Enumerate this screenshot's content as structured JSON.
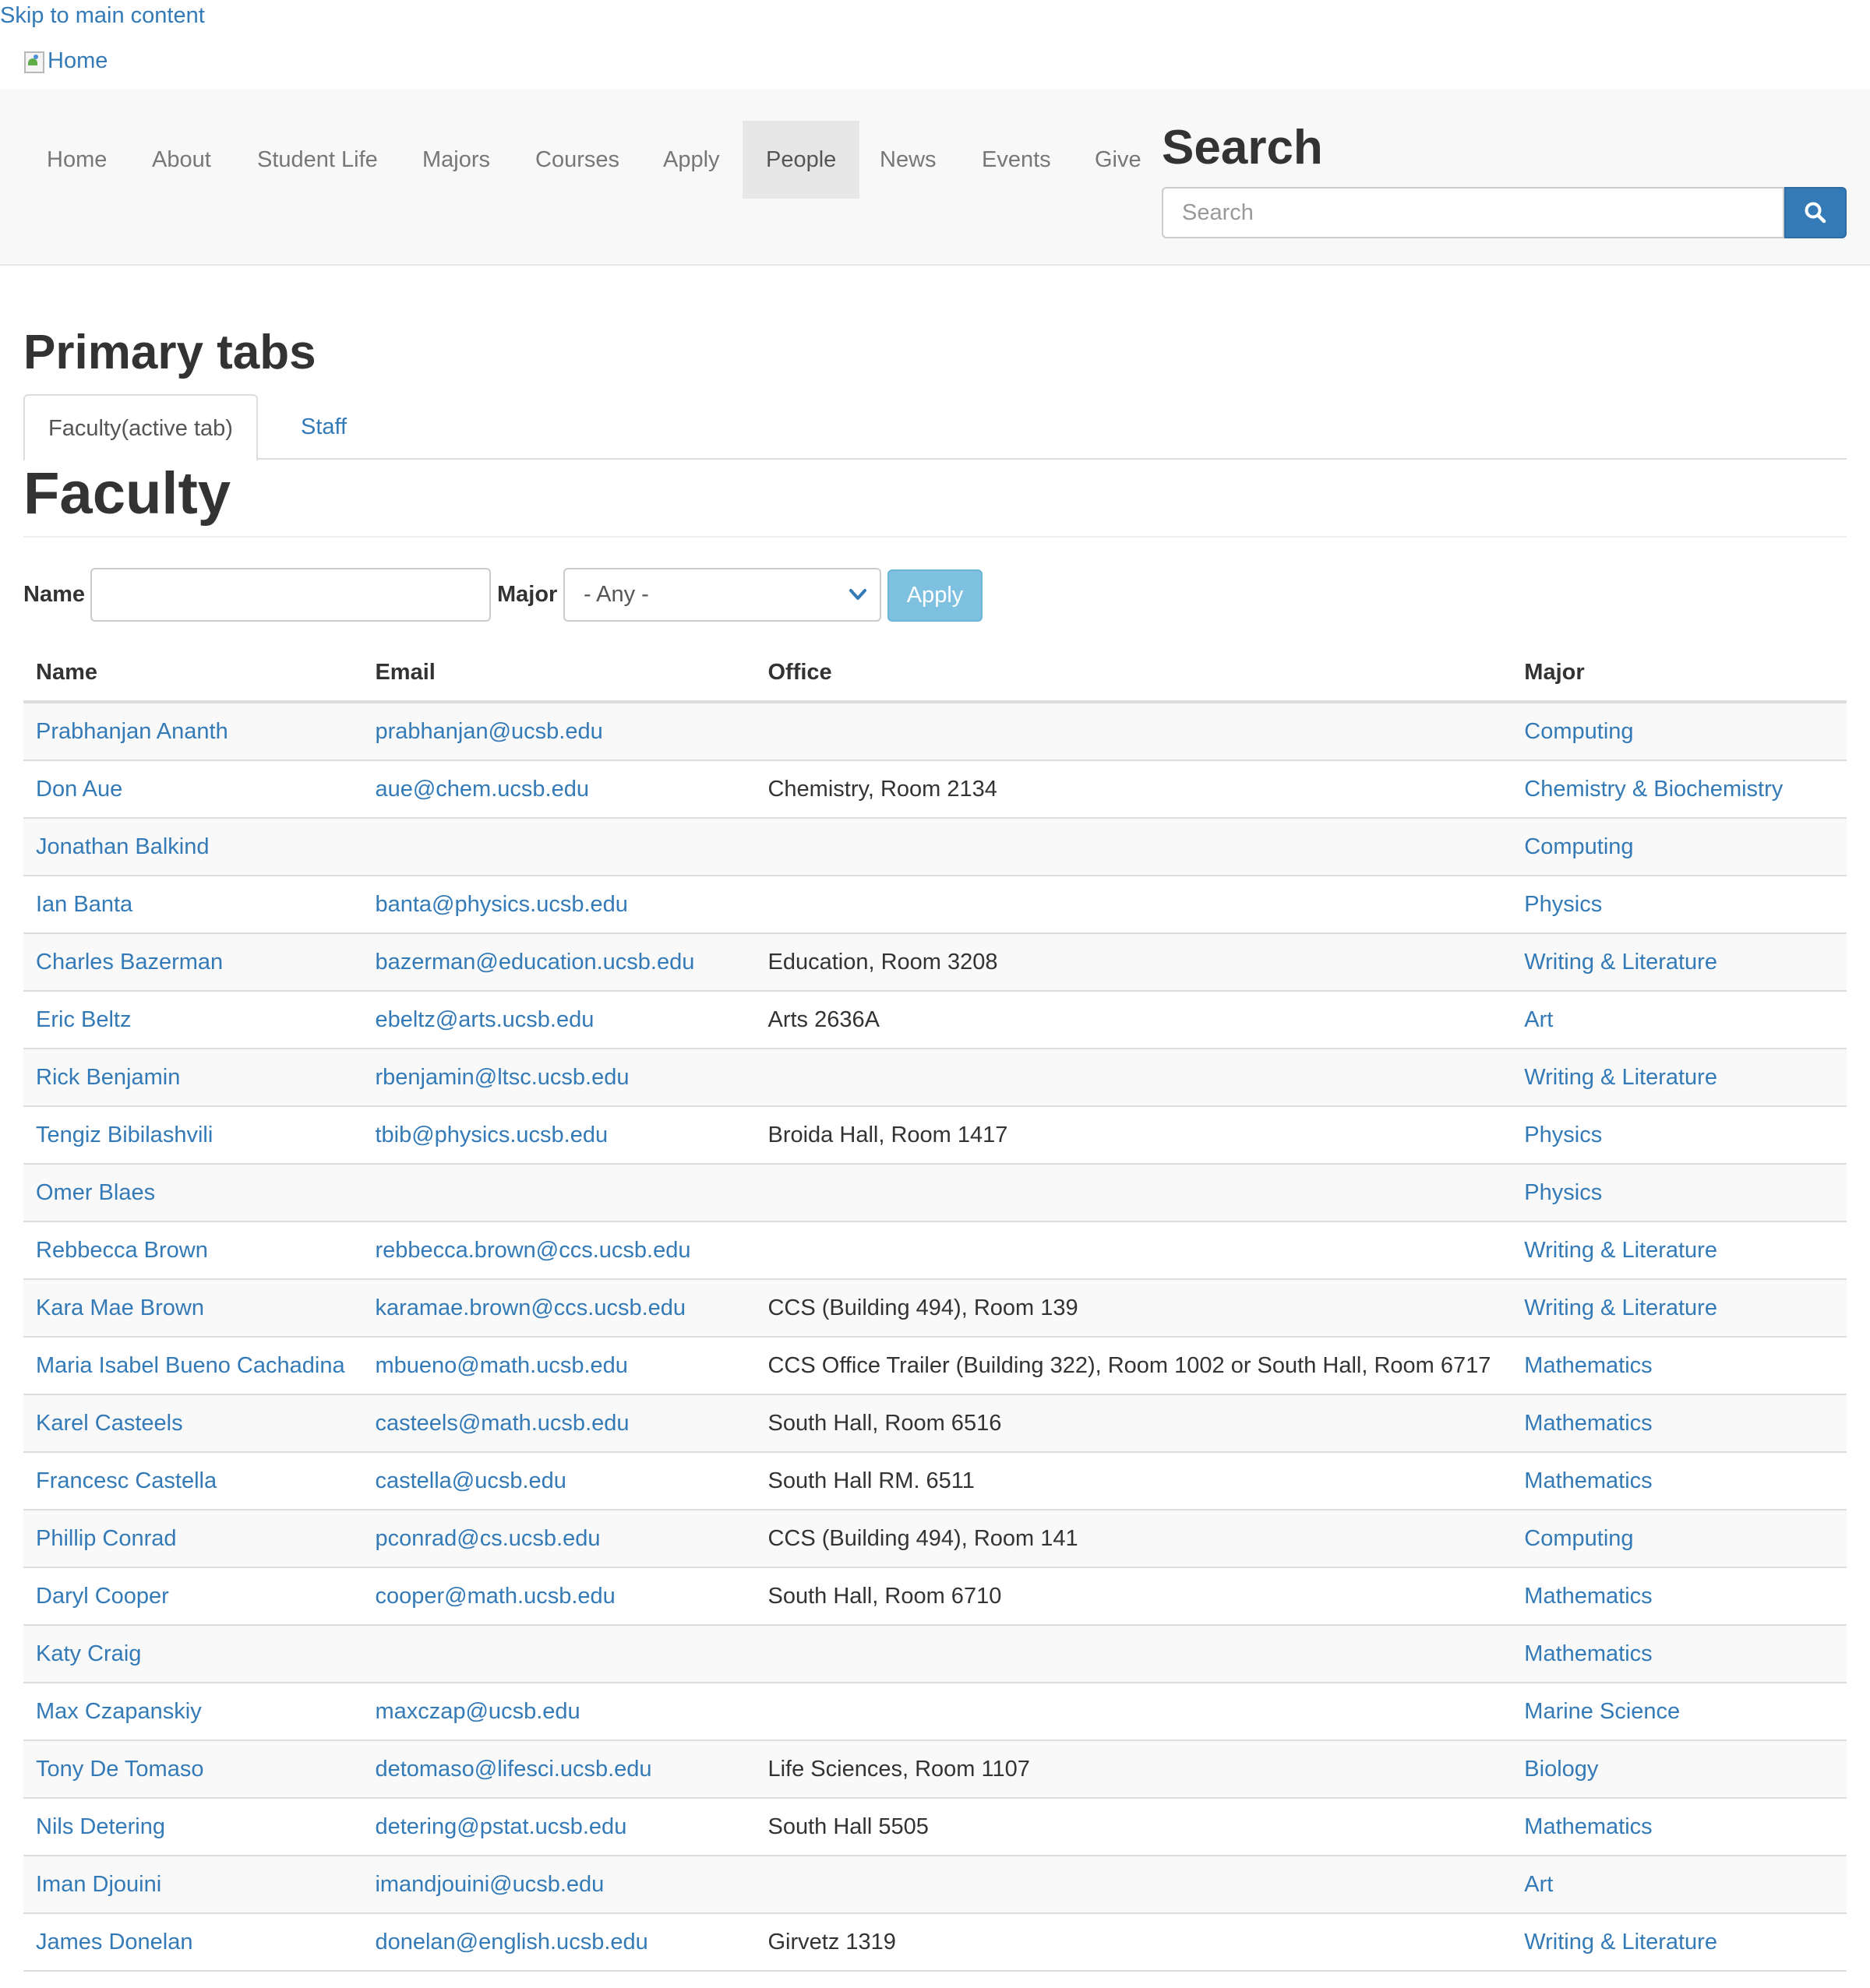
{
  "skip_link": "Skip to main content",
  "logo_alt": "Home",
  "nav": {
    "items": [
      "Home",
      "About",
      "Student Life",
      "Majors",
      "Courses",
      "Apply",
      "People",
      "News",
      "Events",
      "Give"
    ],
    "active": "People"
  },
  "search": {
    "heading": "Search",
    "placeholder": "Search",
    "button_icon": "search-icon"
  },
  "primary_tabs": {
    "heading": "Primary tabs",
    "tabs": [
      "Faculty(active tab)",
      "Staff"
    ]
  },
  "page_title": "Faculty",
  "filters": {
    "name_label": "Name",
    "name_value": "",
    "major_label": "Major",
    "major_selected": "- Any -",
    "apply_label": "Apply"
  },
  "table": {
    "headers": [
      "Name",
      "Email",
      "Office",
      "Major"
    ],
    "rows": [
      {
        "name": "Prabhanjan Ananth",
        "email": "prabhanjan@ucsb.edu",
        "office": "",
        "major": "Computing"
      },
      {
        "name": "Don Aue",
        "email": "aue@chem.ucsb.edu",
        "office": "Chemistry, Room 2134",
        "major": "Chemistry & Biochemistry"
      },
      {
        "name": "Jonathan Balkind",
        "email": "",
        "office": "",
        "major": "Computing"
      },
      {
        "name": "Ian Banta",
        "email": "banta@physics.ucsb.edu",
        "office": "",
        "major": "Physics"
      },
      {
        "name": "Charles Bazerman",
        "email": "bazerman@education.ucsb.edu",
        "office": "Education, Room 3208",
        "major": "Writing & Literature"
      },
      {
        "name": "Eric Beltz",
        "email": "ebeltz@arts.ucsb.edu",
        "office": "Arts 2636A",
        "major": "Art"
      },
      {
        "name": "Rick Benjamin",
        "email": "rbenjamin@ltsc.ucsb.edu",
        "office": "",
        "major": "Writing & Literature"
      },
      {
        "name": "Tengiz Bibilashvili",
        "email": "tbib@physics.ucsb.edu",
        "office": "Broida Hall, Room 1417",
        "major": "Physics"
      },
      {
        "name": "Omer Blaes",
        "email": "",
        "office": "",
        "major": "Physics"
      },
      {
        "name": "Rebbecca Brown",
        "email": "rebbecca.brown@ccs.ucsb.edu",
        "office": "",
        "major": "Writing & Literature"
      },
      {
        "name": "Kara Mae Brown",
        "email": "karamae.brown@ccs.ucsb.edu",
        "office": "CCS (Building 494), Room 139",
        "major": "Writing & Literature"
      },
      {
        "name": "Maria Isabel Bueno Cachadina",
        "email": "mbueno@math.ucsb.edu",
        "office": "CCS Office Trailer (Building 322), Room 1002 or South Hall, Room 6717",
        "major": "Mathematics"
      },
      {
        "name": "Karel Casteels",
        "email": "casteels@math.ucsb.edu",
        "office": "South Hall, Room 6516",
        "major": "Mathematics"
      },
      {
        "name": "Francesc Castella",
        "email": "castella@ucsb.edu",
        "office": "South Hall RM. 6511",
        "major": "Mathematics"
      },
      {
        "name": "Phillip Conrad",
        "email": "pconrad@cs.ucsb.edu",
        "office": "CCS (Building 494), Room 141",
        "major": "Computing"
      },
      {
        "name": "Daryl Cooper",
        "email": "cooper@math.ucsb.edu",
        "office": "South Hall, Room 6710",
        "major": "Mathematics"
      },
      {
        "name": "Katy Craig",
        "email": "",
        "office": "",
        "major": "Mathematics"
      },
      {
        "name": "Max Czapanskiy",
        "email": "maxczap@ucsb.edu",
        "office": "",
        "major": "Marine Science"
      },
      {
        "name": "Tony De Tomaso",
        "email": "detomaso@lifesci.ucsb.edu",
        "office": "Life Sciences, Room 1107",
        "major": "Biology"
      },
      {
        "name": "Nils Detering",
        "email": "detering@pstat.ucsb.edu",
        "office": "South Hall 5505",
        "major": "Mathematics"
      },
      {
        "name": "Iman Djouini",
        "email": "imandjouini@ucsb.edu",
        "office": "",
        "major": "Art"
      },
      {
        "name": "James Donelan",
        "email": "donelan@english.ucsb.edu",
        "office": "Girvetz 1319",
        "major": "Writing & Literature"
      }
    ]
  },
  "colors": {
    "link": "#337ab7",
    "navbar_bg": "#f8f8f8",
    "nav_active_bg": "#e7e7e7",
    "apply_button": "#7ec0e0",
    "search_button": "#337ab7"
  }
}
